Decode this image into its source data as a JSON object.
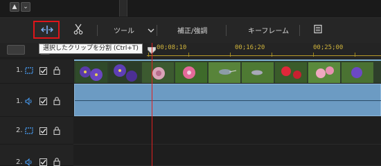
{
  "tooltip": {
    "text": "選択したクリップを分割 (Ctrl+T)"
  },
  "toolbar": {
    "split_icon": "split-clip-icon",
    "cut_icon": "scissors-icon",
    "tools_label": "ツール",
    "tools_dropdown_icon": "chevron-down-icon",
    "correction_label": "補正/強調",
    "keyframe_label": "キーフレーム",
    "menu_icon": "clip-list-icon"
  },
  "ruler": {
    "labels": [
      "00;08;10",
      "00;16;20",
      "00;25;00"
    ]
  },
  "tracks": [
    {
      "number": "1.",
      "type": "video"
    },
    {
      "number": "1.",
      "type": "audio"
    },
    {
      "number": "2.",
      "type": "video"
    },
    {
      "number": "2.",
      "type": "audio"
    }
  ],
  "colors": {
    "highlight": "#e0151a",
    "playhead": "#e02020",
    "audio_clip": "#6c9bc3",
    "ruler_text": "#d0b43c"
  }
}
